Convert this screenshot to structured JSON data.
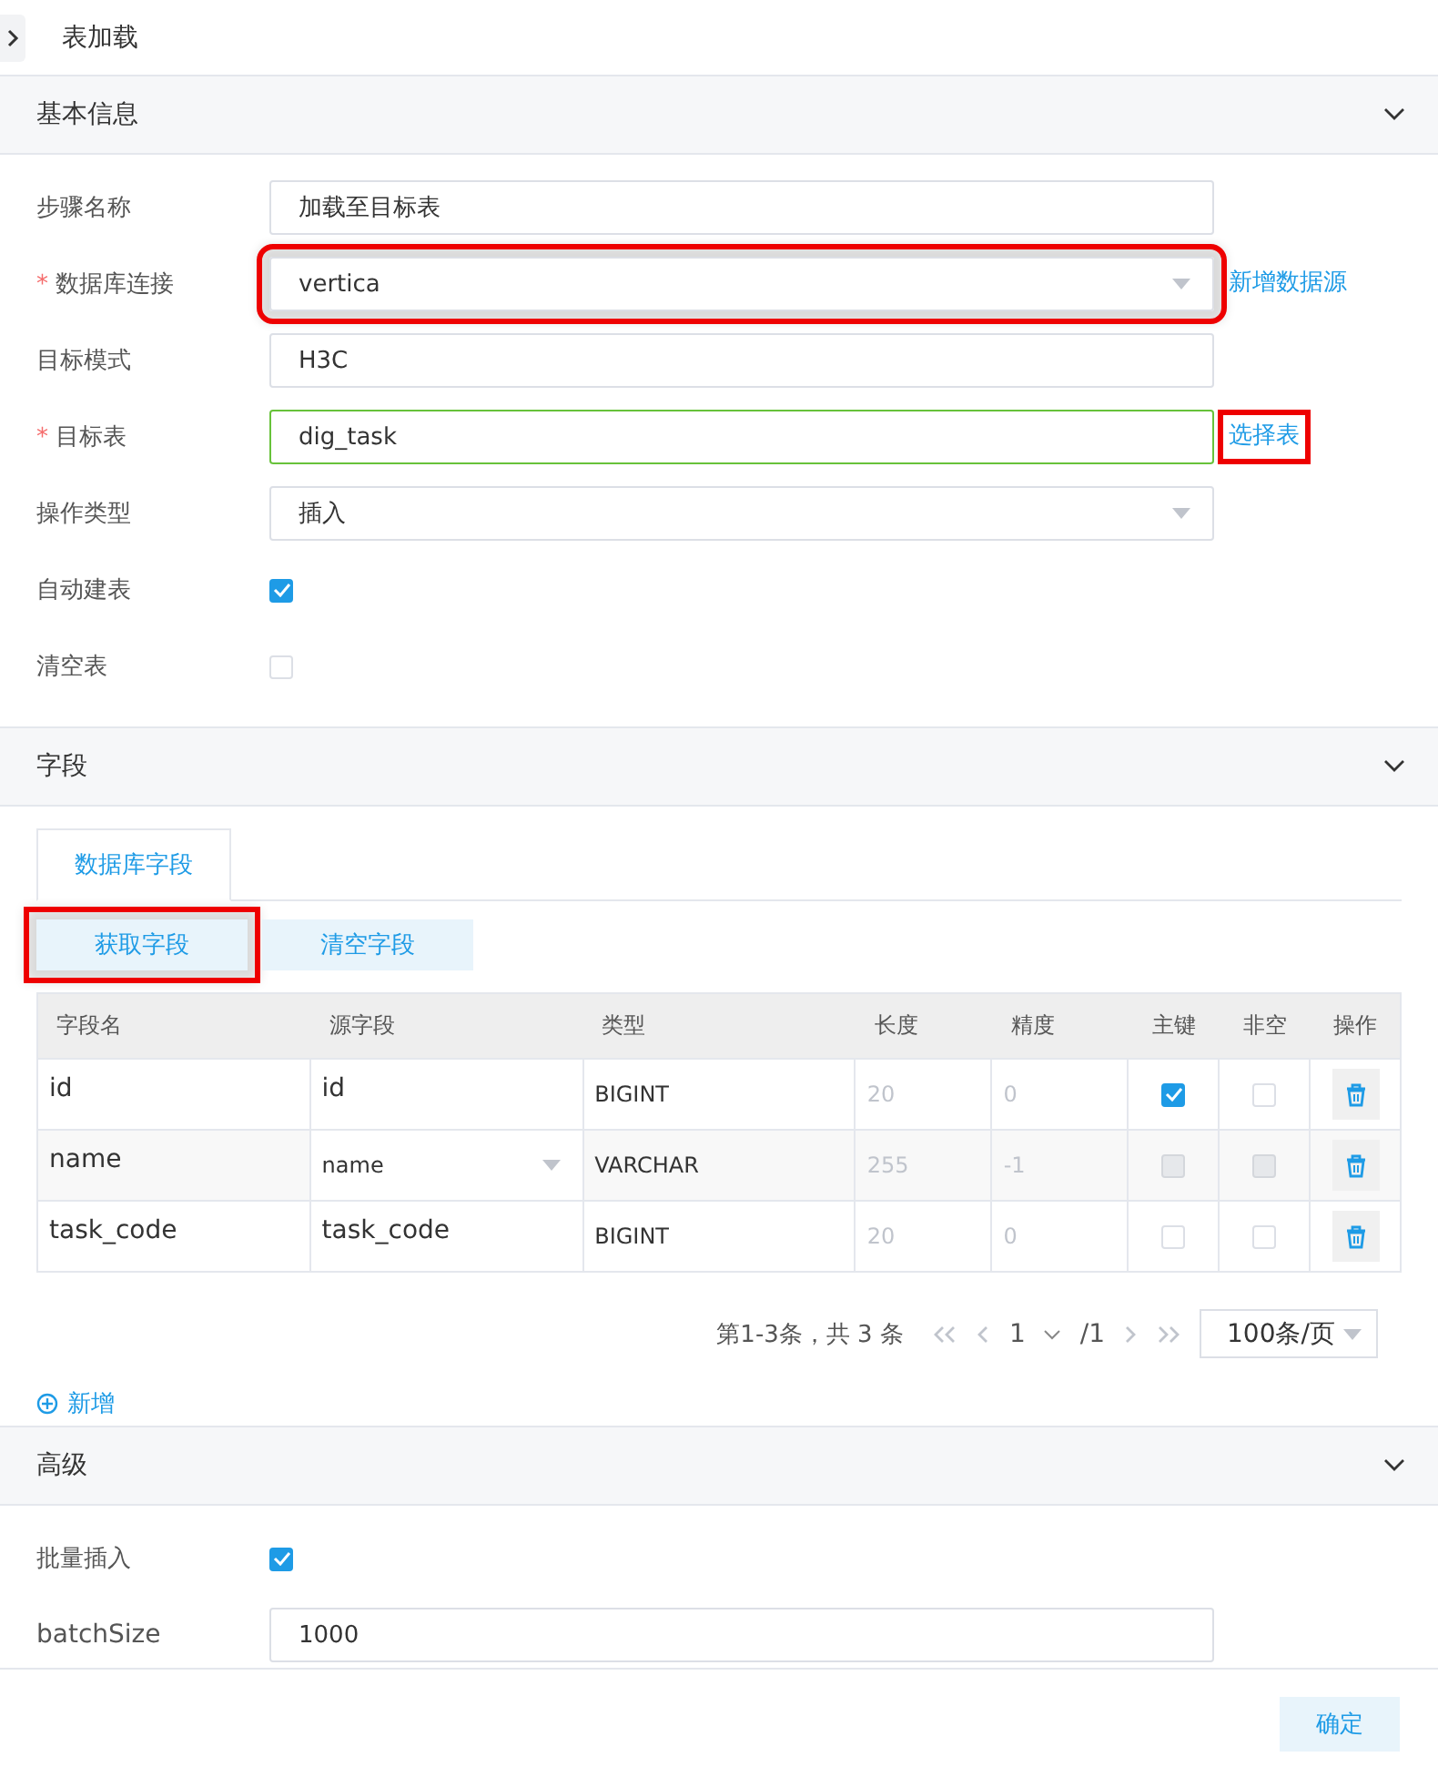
{
  "title": "表加载",
  "basic": {
    "heading": "基本信息",
    "fields": [
      {
        "kind": "input",
        "label": "步骤名称",
        "value": "加载至目标表",
        "highlighted": false,
        "focused": false
      },
      {
        "kind": "select",
        "label": "数据库连接",
        "required_mark": "*",
        "value": "vertica",
        "highlighted": true,
        "focused": false,
        "link": {
          "text": "新增数据源",
          "highlighted": false
        }
      },
      {
        "kind": "input",
        "label": "目标模式",
        "value": "H3C",
        "highlighted": false,
        "focused": false
      },
      {
        "kind": "input",
        "label": "目标表",
        "required_mark": "*",
        "value": "dig_task",
        "highlighted": false,
        "focused": true,
        "link": {
          "text": "选择表",
          "highlighted": true
        }
      },
      {
        "kind": "select",
        "label": "操作类型",
        "value": "插入",
        "highlighted": false,
        "focused": false
      },
      {
        "kind": "checkbox",
        "label": "自动建表",
        "checked": true
      },
      {
        "kind": "checkbox",
        "label": "清空表",
        "checked": false
      }
    ]
  },
  "fields_section": {
    "heading": "字段",
    "tabs": [
      {
        "label": "数据库字段",
        "selected": true
      }
    ],
    "buttons": [
      {
        "label": "获取字段",
        "highlighted": true
      },
      {
        "label": "清空字段",
        "highlighted": false
      }
    ],
    "columns": [
      "字段名",
      "源字段",
      "类型",
      "长度",
      "精度",
      "主键",
      "非空",
      "操作"
    ],
    "rows": [
      {
        "name": "id",
        "source": {
          "kind": "text",
          "value": "id"
        },
        "type": "BIGINT",
        "length": "20",
        "precision": "0",
        "pk": {
          "checked": true,
          "disabled": false
        },
        "not_null": {
          "checked": false,
          "disabled": false
        }
      },
      {
        "name": "name",
        "source": {
          "kind": "select",
          "value": "name"
        },
        "type": "VARCHAR",
        "length": "255",
        "precision": "-1",
        "pk": {
          "checked": false,
          "disabled": true
        },
        "not_null": {
          "checked": false,
          "disabled": true
        }
      },
      {
        "name": "task_code",
        "source": {
          "kind": "text",
          "value": "task_code"
        },
        "type": "BIGINT",
        "length": "20",
        "precision": "0",
        "pk": {
          "checked": false,
          "disabled": false
        },
        "not_null": {
          "checked": false,
          "disabled": false
        }
      }
    ],
    "pagination": {
      "summary": "第1-3条，共 3 条",
      "page": "1",
      "total": "/1",
      "page_size": "100条/页"
    },
    "add_label": "新增"
  },
  "advanced": {
    "heading": "高级",
    "fields": [
      {
        "kind": "checkbox",
        "label": "批量插入",
        "checked": true
      },
      {
        "kind": "input",
        "label": "batchSize",
        "value": "1000",
        "highlighted": false
      }
    ]
  },
  "confirm": "确定"
}
